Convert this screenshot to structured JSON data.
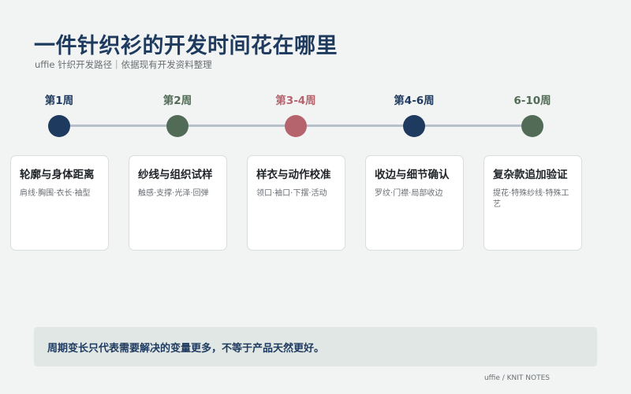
{
  "title": "一件针织衫的开发时间花在哪里",
  "subtitle": "uffie 针织开发路径｜依据现有开发资料整理",
  "colors": {
    "navy": "#1e3a5f",
    "green": "#526b56",
    "red": "#b5646e",
    "track": "#b7c0ca"
  },
  "timeline": [
    {
      "week": "第1周",
      "color": "#1e3a5f",
      "card_title": "轮廓与身体距离",
      "card_desc": "肩线·胸围·衣长·袖型"
    },
    {
      "week": "第2周",
      "color": "#526b56",
      "card_title": "纱线与组织试样",
      "card_desc": "触感·支撑·光泽·回弹"
    },
    {
      "week": "第3-4周",
      "color": "#b5646e",
      "card_title": "样衣与动作校准",
      "card_desc": "领口·袖口·下摆·活动"
    },
    {
      "week": "第4-6周",
      "color": "#1e3a5f",
      "card_title": "收边与细节确认",
      "card_desc": "罗纹·门襟·局部收边"
    },
    {
      "week": "6-10周",
      "color": "#526b56",
      "card_title": "复杂款追加验证",
      "card_desc": "提花·特殊纱线·特殊工艺"
    }
  ],
  "note": "周期变长只代表需要解决的变量更多，不等于产品天然更好。",
  "footer": "uffie / KNIT NOTES"
}
